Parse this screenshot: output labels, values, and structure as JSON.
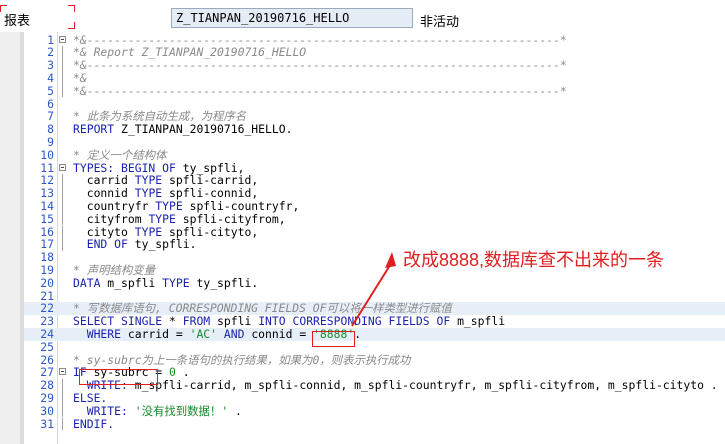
{
  "header": {
    "label": "报表",
    "program_name": "Z_TIANPAN_20190716_HELLO",
    "status": "非活动"
  },
  "annotation": {
    "text": "改成8888,数据库查不出来的一条"
  },
  "code_lines": [
    {
      "num": "1",
      "segments": [
        {
          "c": "cm",
          "t": "*&---------------------------------------------------------------------*"
        }
      ]
    },
    {
      "num": "2",
      "segments": [
        {
          "c": "cm",
          "t": "*& Report Z_TIANPAN_20190716_HELLO"
        }
      ]
    },
    {
      "num": "3",
      "segments": [
        {
          "c": "cm",
          "t": "*&---------------------------------------------------------------------*"
        }
      ]
    },
    {
      "num": "4",
      "segments": [
        {
          "c": "cm",
          "t": "*&"
        }
      ]
    },
    {
      "num": "5",
      "segments": [
        {
          "c": "cm",
          "t": "*&---------------------------------------------------------------------*"
        }
      ]
    },
    {
      "num": "6",
      "segments": []
    },
    {
      "num": "7",
      "segments": [
        {
          "c": "cm",
          "t": "* 此条为系统自动生成，为程序名"
        }
      ]
    },
    {
      "num": "8",
      "segments": [
        {
          "c": "kw",
          "t": "REPORT"
        },
        {
          "c": "id",
          "t": " Z_TIANPAN_20190716_HELLO."
        }
      ]
    },
    {
      "num": "9",
      "segments": []
    },
    {
      "num": "10",
      "segments": [
        {
          "c": "cm",
          "t": "* 定义一个结构体"
        }
      ]
    },
    {
      "num": "11",
      "segments": [
        {
          "c": "kw",
          "t": "TYPES: BEGIN OF"
        },
        {
          "c": "id",
          "t": " ty_spfli,"
        }
      ]
    },
    {
      "num": "12",
      "segments": [
        {
          "c": "id",
          "t": "  carrid "
        },
        {
          "c": "kw",
          "t": "TYPE"
        },
        {
          "c": "id",
          "t": " spfli-carrid,"
        }
      ]
    },
    {
      "num": "13",
      "segments": [
        {
          "c": "id",
          "t": "  connid "
        },
        {
          "c": "kw",
          "t": "TYPE"
        },
        {
          "c": "id",
          "t": " spfli-connid,"
        }
      ]
    },
    {
      "num": "14",
      "segments": [
        {
          "c": "id",
          "t": "  countryfr "
        },
        {
          "c": "kw",
          "t": "TYPE"
        },
        {
          "c": "id",
          "t": " spfli-countryfr,"
        }
      ]
    },
    {
      "num": "15",
      "segments": [
        {
          "c": "id",
          "t": "  cityfrom "
        },
        {
          "c": "kw",
          "t": "TYPE"
        },
        {
          "c": "id",
          "t": " spfli-cityfrom,"
        }
      ]
    },
    {
      "num": "16",
      "segments": [
        {
          "c": "id",
          "t": "  cityto "
        },
        {
          "c": "kw",
          "t": "TYPE"
        },
        {
          "c": "id",
          "t": " spfli-cityto,"
        }
      ]
    },
    {
      "num": "17",
      "segments": [
        {
          "c": "kw",
          "t": "  END OF"
        },
        {
          "c": "id",
          "t": " ty_spfli."
        }
      ]
    },
    {
      "num": "18",
      "segments": []
    },
    {
      "num": "19",
      "segments": [
        {
          "c": "cm",
          "t": "* 声明结构变量"
        }
      ]
    },
    {
      "num": "20",
      "segments": [
        {
          "c": "kw",
          "t": "DATA"
        },
        {
          "c": "id",
          "t": " m_spfli "
        },
        {
          "c": "kw",
          "t": "TYPE"
        },
        {
          "c": "id",
          "t": " ty_spfli."
        }
      ]
    },
    {
      "num": "21",
      "segments": []
    },
    {
      "num": "22",
      "segments": [
        {
          "c": "cm",
          "t": "* 写数据库语句, CORRESPONDING FIELDS OF可以将一样类型进行赋值"
        }
      ]
    },
    {
      "num": "23",
      "segments": [
        {
          "c": "kw",
          "t": "SELECT SINGLE"
        },
        {
          "c": "id",
          "t": " * "
        },
        {
          "c": "kw",
          "t": "FROM"
        },
        {
          "c": "id",
          "t": " spfli "
        },
        {
          "c": "kw",
          "t": "INTO CORRESPONDING FIELDS OF"
        },
        {
          "c": "id",
          "t": " m_spfli"
        }
      ]
    },
    {
      "num": "24",
      "segments": [
        {
          "c": "kw",
          "t": "  WHERE"
        },
        {
          "c": "id",
          "t": " carrid = "
        },
        {
          "c": "st",
          "t": "'AC'"
        },
        {
          "c": "kw",
          "t": " AND"
        },
        {
          "c": "id",
          "t": " connid = "
        },
        {
          "c": "st",
          "t": "'8888'"
        },
        {
          "c": "id",
          "t": "."
        }
      ]
    },
    {
      "num": "25",
      "segments": []
    },
    {
      "num": "26",
      "segments": [
        {
          "c": "cm",
          "t": "* sy-subrc为上一条语句的执行结果，如果为0，则表示执行成功"
        }
      ]
    },
    {
      "num": "27",
      "segments": [
        {
          "c": "kw",
          "t": "IF"
        },
        {
          "c": "id",
          "t": " sy-subrc = "
        },
        {
          "c": "st",
          "t": "0"
        },
        {
          "c": "id",
          "t": " ."
        }
      ]
    },
    {
      "num": "28",
      "segments": [
        {
          "c": "kw",
          "t": "  WRITE:"
        },
        {
          "c": "id",
          "t": " m_spfli-carrid, m_spfli-connid, m_spfli-countryfr, m_spfli-cityfrom, m_spfli-cityto ."
        }
      ]
    },
    {
      "num": "29",
      "segments": [
        {
          "c": "kw",
          "t": "ELSE."
        }
      ]
    },
    {
      "num": "30",
      "segments": [
        {
          "c": "kw",
          "t": "  WRITE:"
        },
        {
          "c": "st",
          "t": " '没有找到数据！'"
        },
        {
          "c": "id",
          "t": " ."
        }
      ]
    },
    {
      "num": "31",
      "segments": [
        {
          "c": "kw",
          "t": "ENDIF."
        }
      ]
    }
  ]
}
